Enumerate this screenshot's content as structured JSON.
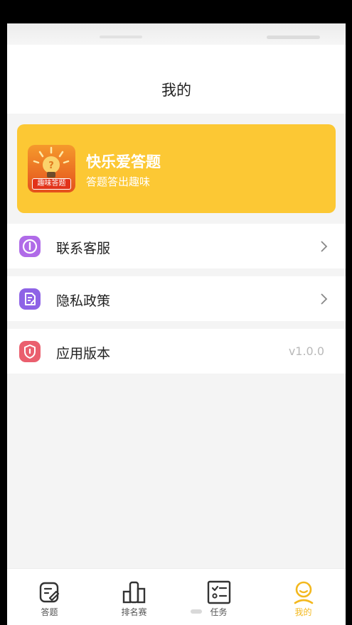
{
  "header": {
    "title": "我的"
  },
  "app_card": {
    "logo_label": "趣味答题",
    "name": "快乐爱答题",
    "slogan": "答题答出趣味"
  },
  "menu": [
    {
      "label": "联系客服",
      "icon": "info-icon",
      "color": "#b06be8",
      "value": ""
    },
    {
      "label": "隐私政策",
      "icon": "document-edit-icon",
      "color": "#8e63e6",
      "value": ""
    },
    {
      "label": "应用版本",
      "icon": "shield-icon",
      "color": "#ea5f6e",
      "value": "v1.0.0"
    }
  ],
  "tabbar": [
    {
      "label": "答题",
      "icon": "edit-note-icon",
      "active": false
    },
    {
      "label": "排名赛",
      "icon": "bar-chart-icon",
      "active": false
    },
    {
      "label": "任务",
      "icon": "checklist-icon",
      "active": false
    },
    {
      "label": "我的",
      "icon": "user-icon",
      "active": true
    }
  ],
  "colors": {
    "accent": "#fcc834",
    "active_tab": "#f3b81e",
    "background": "#f4f4f4"
  }
}
